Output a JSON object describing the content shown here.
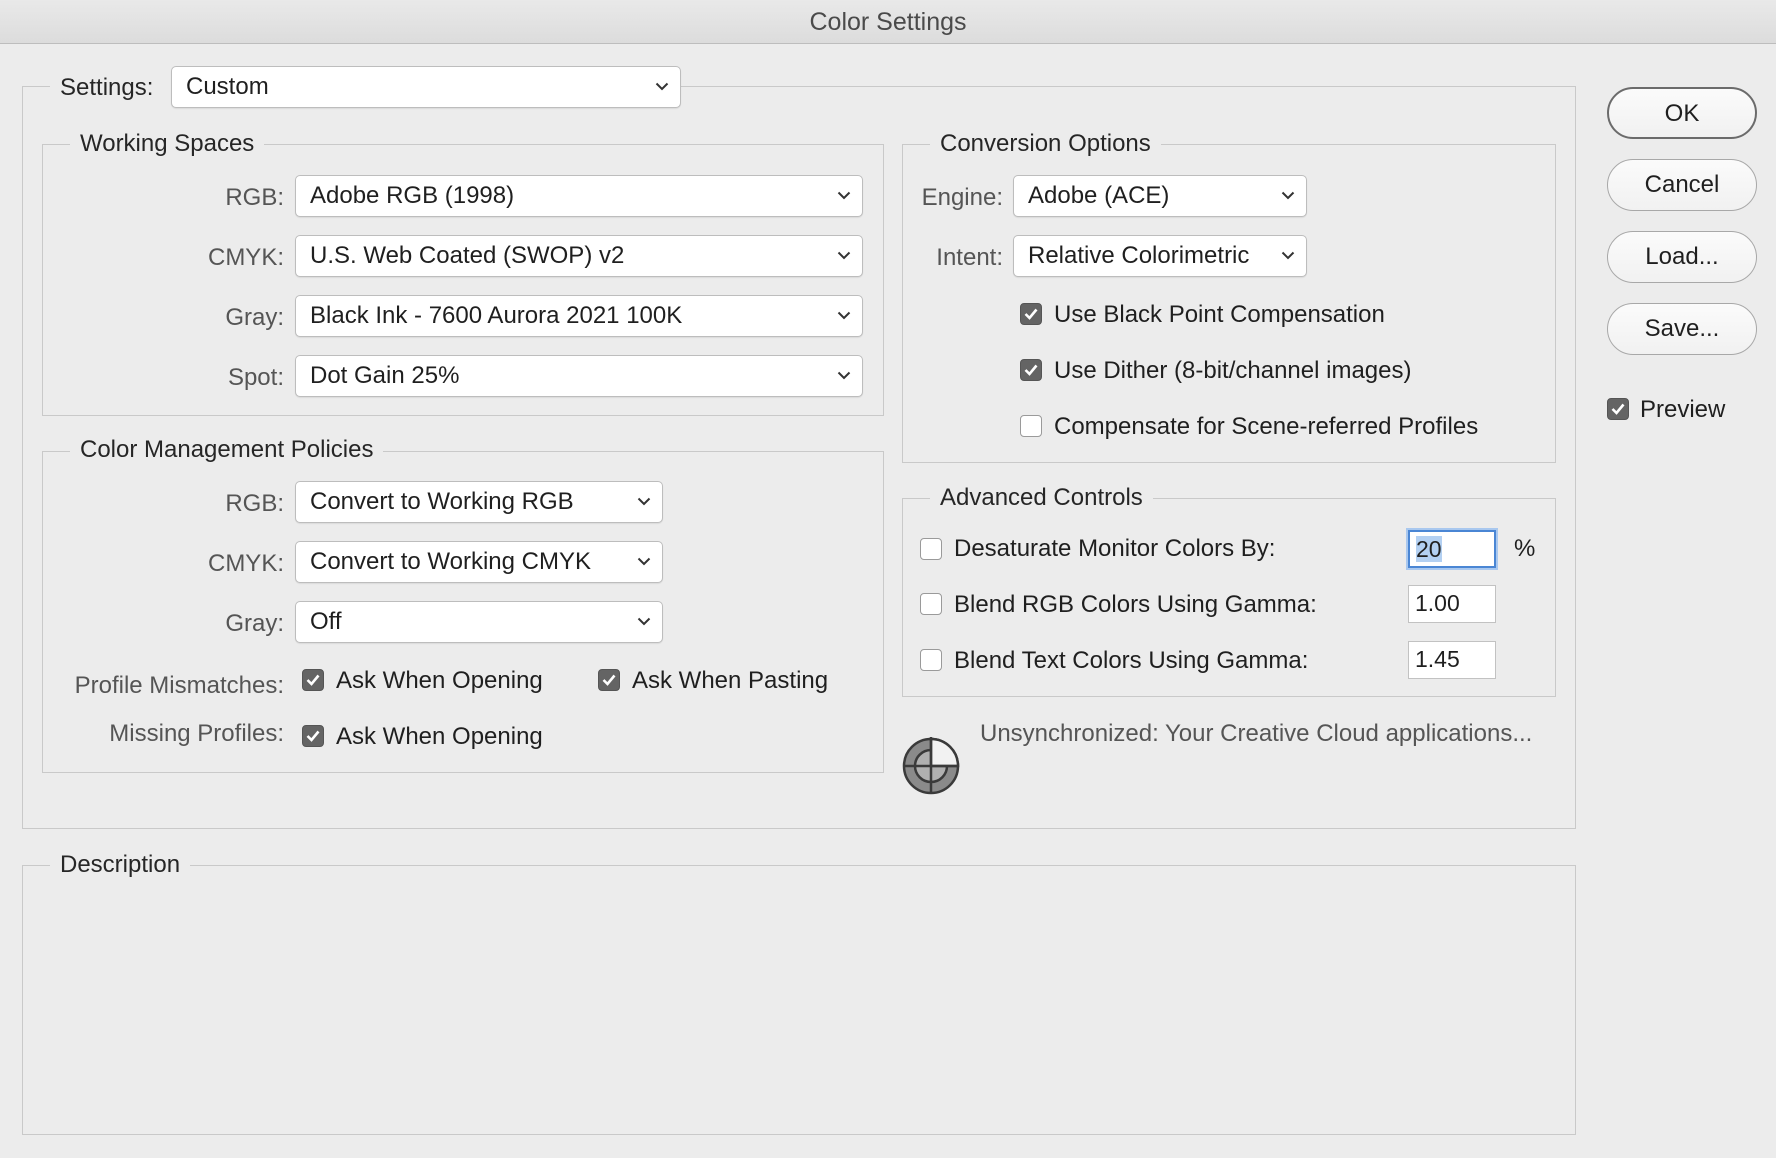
{
  "window": {
    "title": "Color Settings"
  },
  "settings": {
    "label": "Settings:",
    "value": "Custom"
  },
  "working_spaces": {
    "legend": "Working Spaces",
    "rgb": {
      "label": "RGB:",
      "value": "Adobe RGB (1998)"
    },
    "cmyk": {
      "label": "CMYK:",
      "value": "U.S. Web Coated (SWOP) v2"
    },
    "gray": {
      "label": "Gray:",
      "value": "Black Ink - 7600 Aurora 2021 100K"
    },
    "spot": {
      "label": "Spot:",
      "value": "Dot Gain 25%"
    }
  },
  "policies": {
    "legend": "Color Management Policies",
    "rgb": {
      "label": "RGB:",
      "value": "Convert to Working RGB"
    },
    "cmyk": {
      "label": "CMYK:",
      "value": "Convert to Working CMYK"
    },
    "gray": {
      "label": "Gray:",
      "value": "Off"
    },
    "profile_mismatches": {
      "label": "Profile Mismatches:",
      "ask_opening": {
        "label": "Ask When Opening",
        "checked": true
      },
      "ask_pasting": {
        "label": "Ask When Pasting",
        "checked": true
      }
    },
    "missing_profiles": {
      "label": "Missing Profiles:",
      "ask_opening": {
        "label": "Ask When Opening",
        "checked": true
      }
    }
  },
  "conversion": {
    "legend": "Conversion Options",
    "engine": {
      "label": "Engine:",
      "value": "Adobe (ACE)"
    },
    "intent": {
      "label": "Intent:",
      "value": "Relative Colorimetric"
    },
    "black_point": {
      "label": "Use Black Point Compensation",
      "checked": true
    },
    "dither": {
      "label": "Use Dither (8-bit/channel images)",
      "checked": true
    },
    "scene_referred": {
      "label": "Compensate for Scene-referred Profiles",
      "checked": false
    }
  },
  "advanced": {
    "legend": "Advanced Controls",
    "desaturate": {
      "label": "Desaturate Monitor Colors By:",
      "checked": false,
      "value": "20",
      "unit": "%"
    },
    "blend_rgb": {
      "label": "Blend RGB Colors Using Gamma:",
      "checked": false,
      "value": "1.00"
    },
    "blend_text": {
      "label": "Blend Text Colors Using Gamma:",
      "checked": false,
      "value": "1.45"
    }
  },
  "sync": {
    "icon": "sync-status-icon",
    "text": "Unsynchronized: Your Creative Cloud applications..."
  },
  "description": {
    "legend": "Description",
    "text": ""
  },
  "buttons": {
    "ok": "OK",
    "cancel": "Cancel",
    "load": "Load...",
    "save": "Save..."
  },
  "preview": {
    "label": "Preview",
    "checked": true
  },
  "colors": {
    "focus_ring": "#4a86d4",
    "selection": "#b3d0f2",
    "checkbox_on": "#646464"
  }
}
